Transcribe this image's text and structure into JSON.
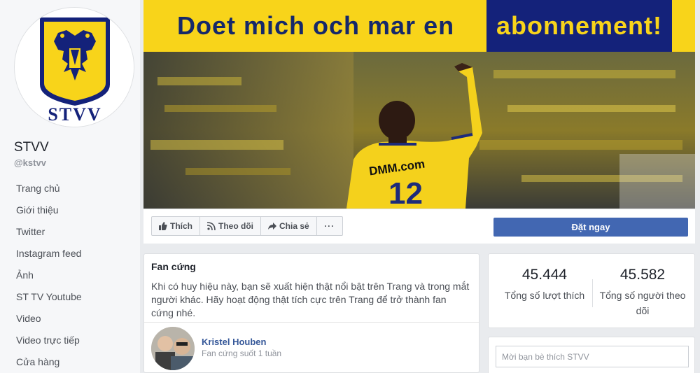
{
  "page": {
    "name": "STVV",
    "handle": "@kstvv",
    "logo_text": "STVV"
  },
  "sidebar": {
    "items": [
      {
        "label": "Trang chủ"
      },
      {
        "label": "Giới thiệu"
      },
      {
        "label": "Twitter"
      },
      {
        "label": "Instagram feed"
      },
      {
        "label": "Ảnh"
      },
      {
        "label": "ST TV Youtube"
      },
      {
        "label": "Video"
      },
      {
        "label": "Video trực tiếp"
      },
      {
        "label": "Cửa hàng"
      }
    ]
  },
  "cover": {
    "slogan_part1": "Doet mich och mar en",
    "slogan_part2": "abonnement!",
    "jersey_sponsor": "DMM.com",
    "jersey_number": "12"
  },
  "actions": {
    "like_label": "Thích",
    "follow_label": "Theo dõi",
    "share_label": "Chia sẻ",
    "more_label": "···",
    "book_label": "Đặt ngay"
  },
  "fan_card": {
    "title": "Fan cứng",
    "description": "Khi có huy hiệu này, bạn sẽ xuất hiện thật nổi bật trên Trang và trong mắt người khác. Hãy hoạt động thật tích cực trên Trang để trở thành fan cứng nhé.",
    "fan_name": "Kristel Houben",
    "fan_subtitle": "Fan cứng suốt 1 tuần"
  },
  "stats": {
    "likes_count": "45.444",
    "likes_label": "Tổng số lượt thích",
    "followers_count": "45.582",
    "followers_label": "Tổng số người theo dõi"
  },
  "invite": {
    "placeholder": "Mời bạn bè thích STVV"
  },
  "colors": {
    "brand_blue": "#4267b2",
    "club_yellow": "#f8d41a",
    "club_navy": "#14227a",
    "link": "#365899"
  }
}
